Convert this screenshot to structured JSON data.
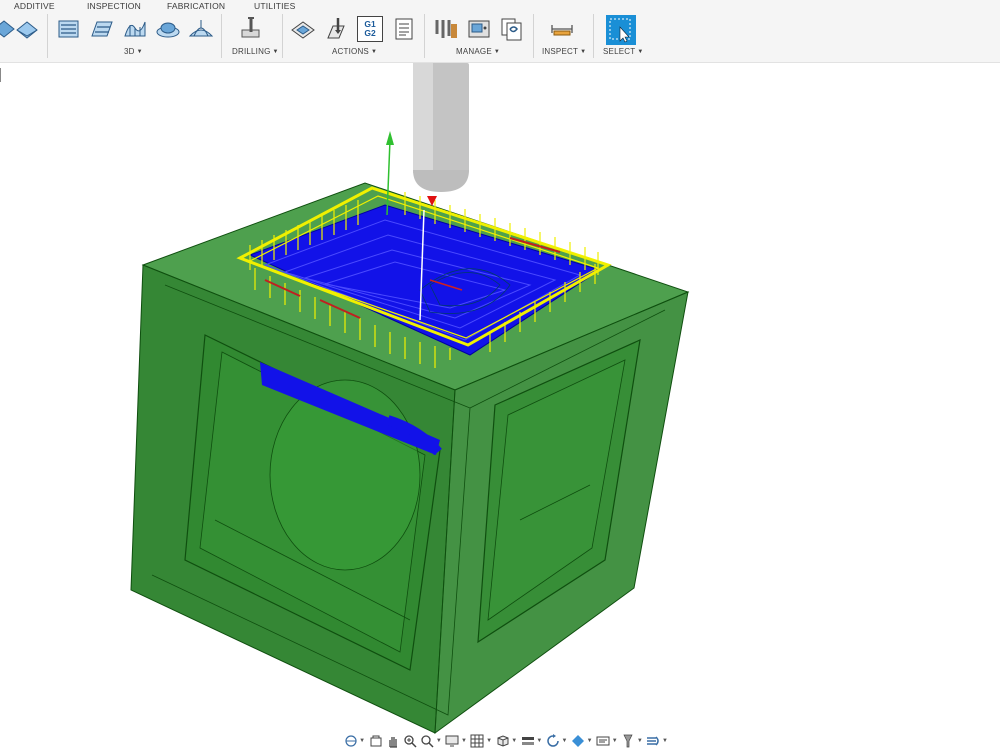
{
  "tabs": [
    "ADDITIVE",
    "INSPECTION",
    "FABRICATION",
    "UTILITIES"
  ],
  "groups": {
    "three_d": "3D",
    "drilling": "DRILLING",
    "actions": "ACTIONS",
    "manage": "MANAGE",
    "inspect": "INSPECT",
    "select": "SELECT"
  },
  "actions_g1g2_icon_text": "G1\nG2",
  "colors": {
    "stock_green": "#1e7a1e",
    "toolpath_blue": "#1010e6",
    "lead_yellow": "#f0f000",
    "tool_gray": "#bdbdbd",
    "select_blue": "#1a8fd6"
  },
  "icons": {
    "toolbar": [
      "2d-icon",
      "3d-adaptive-icon",
      "3d-pocket-icon",
      "3d-parallel-icon",
      "3d-scallop-icon",
      "3d-contour-icon",
      "drill-icon",
      "simulate-icon",
      "post-process-icon",
      "g1g2-icon",
      "setup-sheet-icon",
      "tool-library-icon",
      "machine-icon",
      "template-icon",
      "measure-icon",
      "select-icon"
    ],
    "navbar": [
      "orbit-icon",
      "pan-icon",
      "look-at-icon",
      "fit-icon",
      "zoom-icon",
      "display-settings-icon",
      "grid-icon",
      "view-cube-icon",
      "visual-style-icon",
      "environment-icon",
      "effects-icon",
      "object-visibility-icon",
      "camera-icon",
      "display-icon"
    ]
  }
}
